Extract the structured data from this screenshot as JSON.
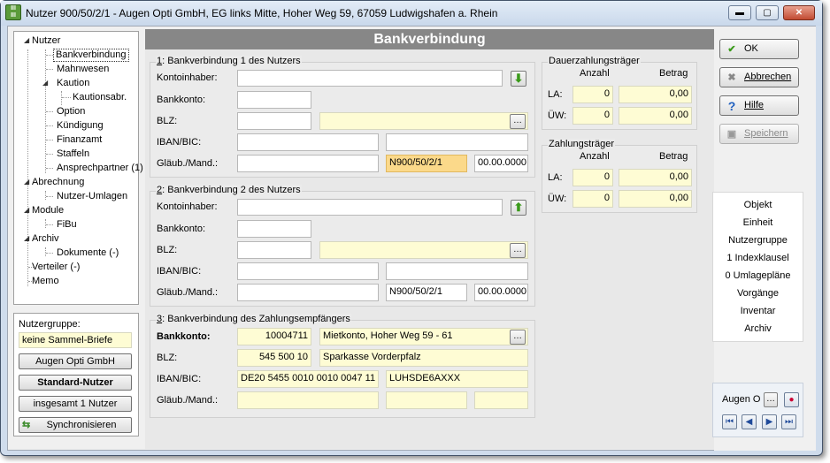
{
  "window": {
    "title": "Nutzer 900/50/2/1 - Augen Opti GmbH, EG links Mitte, Hoher Weg 59, 67059 Ludwigshafen a. Rhein"
  },
  "tree": [
    {
      "label": "Nutzer"
    },
    {
      "label": "Bankverbindung"
    },
    {
      "label": "Mahnwesen"
    },
    {
      "label": "Kaution"
    },
    {
      "label": "Kautionsabr."
    },
    {
      "label": "Option"
    },
    {
      "label": "Kündigung"
    },
    {
      "label": "Finanzamt"
    },
    {
      "label": "Staffeln"
    },
    {
      "label": "Ansprechpartner (1)"
    },
    {
      "label": "Abrechnung"
    },
    {
      "label": "Nutzer-Umlagen"
    },
    {
      "label": "Module"
    },
    {
      "label": "FiBu"
    },
    {
      "label": "Archiv"
    },
    {
      "label": "Dokumente (-)"
    },
    {
      "label": "Verteiler (-)"
    },
    {
      "label": "Memo"
    }
  ],
  "nutzergruppe": {
    "label": "Nutzergruppe:",
    "value": "keine Sammel-Briefe",
    "btn_company": "Augen Opti GmbH",
    "btn_standard": "Standard-Nutzer",
    "btn_count": "insgesamt 1 Nutzer",
    "btn_sync": "Synchronisieren"
  },
  "header": "Bankverbindung",
  "bank1": {
    "title_num": "1",
    "title_rest": ": Bankverbindung 1 des Nutzers",
    "lbl_kontoinhaber": "Kontoinhaber:",
    "lbl_bankkonto": "Bankkonto:",
    "lbl_blz": "BLZ:",
    "lbl_iban": "IBAN/BIC:",
    "lbl_glaeub": "Gläub./Mand.:",
    "mandat": "N900/50/2/1",
    "datum": "00.00.0000"
  },
  "bank2": {
    "title_num": "2",
    "title_rest": ": Bankverbindung 2 des Nutzers",
    "lbl_kontoinhaber": "Kontoinhaber:",
    "lbl_bankkonto": "Bankkonto:",
    "lbl_blz": "BLZ:",
    "lbl_iban": "IBAN/BIC:",
    "lbl_glaeub": "Gläub./Mand.:",
    "mandat": "N900/50/2/1",
    "datum": "00.00.0000"
  },
  "bank3": {
    "title_num": "3",
    "title_rest": ": Bankverbindung des Zahlungsempfängers",
    "lbl_bankkonto": "Bankkonto:",
    "lbl_blz": "BLZ:",
    "lbl_iban": "IBAN/BIC:",
    "lbl_glaeub": "Gläub./Mand.:",
    "konto": "10004711",
    "konto_name": "Mietkonto,  Hoher Weg 59 - 61",
    "blz": "545 500 10",
    "bank": "Sparkasse Vorderpfalz",
    "iban": "DE20 5455 0010 0010 0047 11",
    "bic": "LUHSDE6AXXX"
  },
  "dauer": {
    "title": "Dauerzahlungsträger",
    "col_anzahl": "Anzahl",
    "col_betrag": "Betrag",
    "row_la": "LA:",
    "row_uew": "ÜW:",
    "la_anzahl": "0",
    "la_betrag": "0,00",
    "uew_anzahl": "0",
    "uew_betrag": "0,00"
  },
  "zahl": {
    "title": "Zahlungsträger",
    "col_anzahl": "Anzahl",
    "col_betrag": "Betrag",
    "row_la": "LA:",
    "row_uew": "ÜW:",
    "la_anzahl": "0",
    "la_betrag": "0,00",
    "uew_anzahl": "0",
    "uew_betrag": "0,00"
  },
  "buttons": {
    "ok": "OK",
    "abbrechen": "Abbrechen",
    "hilfe": "Hilfe",
    "speichern": "Speichern"
  },
  "info": [
    "Objekt",
    "Einheit",
    "Nutzergruppe",
    "1 Indexklausel",
    "0 Umlagepläne",
    "Vorgänge",
    "Inventar",
    "Archiv"
  ],
  "nav": {
    "record": "Augen O"
  }
}
